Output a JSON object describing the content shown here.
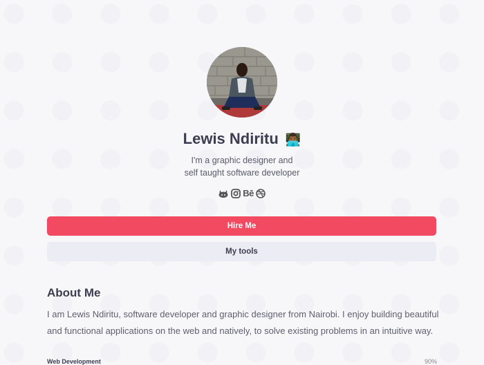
{
  "profile": {
    "name": "Lewis Ndiritu",
    "name_emoji": "👨🏾‍💻",
    "bio_line1": "I'm a graphic designer and",
    "bio_line2": "self taught software developer"
  },
  "socials": [
    {
      "icon": "github-icon"
    },
    {
      "icon": "instagram-icon"
    },
    {
      "icon": "behance-icon",
      "text": "Bē"
    },
    {
      "icon": "dribbble-icon"
    }
  ],
  "buttons": {
    "hire": "Hire Me",
    "tools": "My tools"
  },
  "about": {
    "title": "About Me",
    "text": "I am Lewis Ndiritu, software developer and graphic designer from Nairobi. I enjoy building beautiful and functional applications on the web and natively, to solve existing problems in an intuitive way."
  },
  "skills": [
    {
      "label": "Web Development",
      "percent": "90%"
    }
  ],
  "colors": {
    "accent": "#f24b61",
    "secondary_button": "#ececf4",
    "background": "#f7f7fa"
  }
}
